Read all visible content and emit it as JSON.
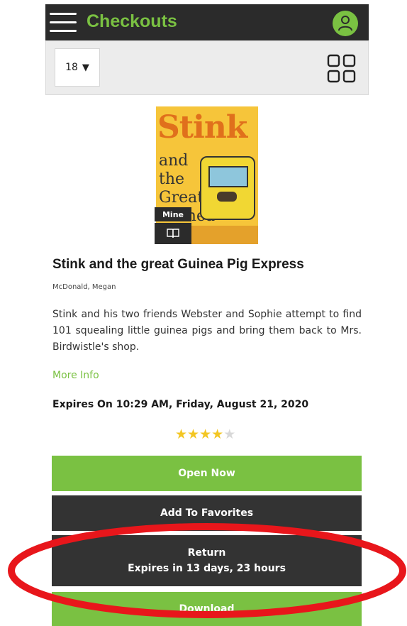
{
  "header": {
    "title": "Checkouts",
    "menu_icon": "hamburger-menu-icon",
    "profile_icon": "user-avatar-icon"
  },
  "toolbar": {
    "items_per_page": "18",
    "dropdown_caret": "▼",
    "view_toggle_icon": "grid-view-icon"
  },
  "book": {
    "cover_title": "Stink",
    "cover_subtitle": "and the Great Guinea Pig Express",
    "ownership_badge": "Mine",
    "format_icon": "book-icon",
    "title": "Stink and the great Guinea Pig Express",
    "author": "McDonald, Megan",
    "description": "Stink and his two friends Webster and Sophie attempt to find 101 squealing little guinea pigs and bring them back to Mrs. Birdwistle's shop.",
    "more_info_label": "More Info",
    "expires_text": "Expires On 10:29 AM, Friday, August 21, 2020",
    "rating": 4,
    "rating_max": 5
  },
  "actions": {
    "open_label": "Open Now",
    "favorites_label": "Add To Favorites",
    "return_label": "Return",
    "return_sublabel": "Expires in 13 days, 23 hours",
    "download_label": "Download"
  },
  "colors": {
    "accent_green": "#7ac142",
    "dark": "#2b2b2b",
    "star": "#f3c623",
    "annotation_red": "#e8161b"
  }
}
